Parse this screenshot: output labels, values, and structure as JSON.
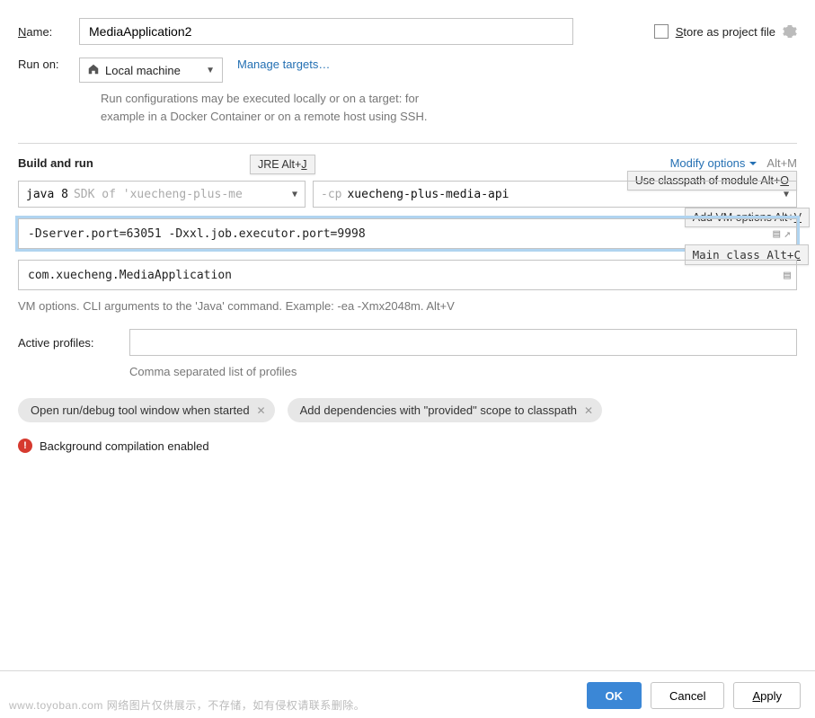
{
  "name_label": "Name:",
  "name_value": "MediaApplication2",
  "store_label": "Store as project file",
  "runon_label": "Run on:",
  "runon_value": "Local machine",
  "manage_link": "Manage targets…",
  "run_desc_l1": "Run configurations may be executed locally or on a target: for",
  "run_desc_l2": "example in a Docker Container or on a remote host using SSH.",
  "build_title": "Build and run",
  "modify_label": "Modify options",
  "modify_short": "Alt+M",
  "callouts": {
    "jre": "JRE Alt+J",
    "classpath": "Use classpath of module Alt+O",
    "vm": "Add VM options Alt+V",
    "main": "Main class Alt+C"
  },
  "jdk_prefix": "java 8",
  "jdk_rest": "SDK of 'xuecheng-plus-me",
  "cp_flag": "-cp",
  "cp_value": "xuecheng-plus-media-api",
  "vm_value": "-Dserver.port=63051 -Dxxl.job.executor.port=9998",
  "main_class": "com.xuecheng.MediaApplication",
  "vm_hint": "VM options. CLI arguments to the 'Java' command. Example: -ea -Xmx2048m. Alt+V",
  "profiles_label": "Active profiles:",
  "profiles_hint": "Comma separated list of profiles",
  "chips": {
    "chip1": "Open run/debug tool window when started",
    "chip2": "Add dependencies with \"provided\" scope to classpath"
  },
  "warn_text": "Background compilation enabled",
  "buttons": {
    "ok": "OK",
    "cancel": "Cancel",
    "apply": "Apply"
  },
  "watermark": "www.toyoban.com 网络图片仅供展示，不存储，如有侵权请联系删除。"
}
